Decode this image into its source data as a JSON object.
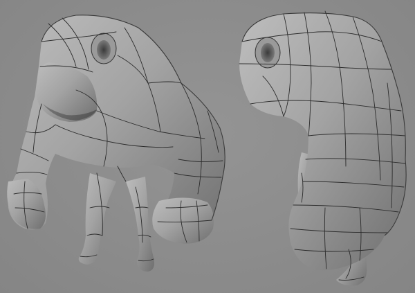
{
  "scene": {
    "background_color": "#8c8c8c",
    "mesh_color": "#a9a9a9",
    "wireframe_color": "#2b2b2b"
  },
  "models": [
    {
      "view": "front-three-quarter"
    },
    {
      "view": "side"
    }
  ]
}
